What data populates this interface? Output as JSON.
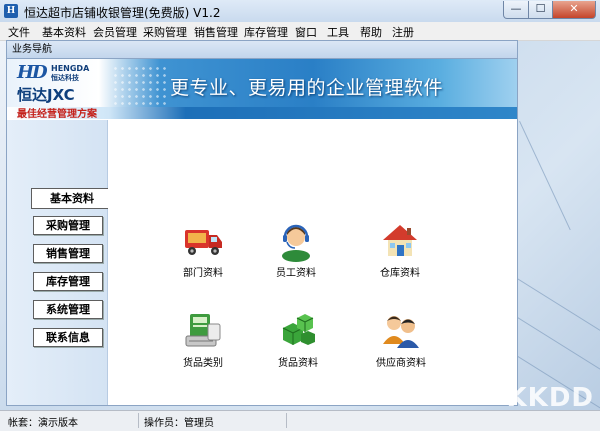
{
  "window": {
    "title": "恒达超市店铺收银管理(免费版) V1.2",
    "icon_label": "H"
  },
  "menu": [
    {
      "label": "文件"
    },
    {
      "label": "基本资料"
    },
    {
      "label": "会员管理"
    },
    {
      "label": "采购管理"
    },
    {
      "label": "销售管理"
    },
    {
      "label": "库存管理"
    },
    {
      "label": "窗口"
    },
    {
      "label": "工具"
    },
    {
      "label": "帮助"
    },
    {
      "label": "注册"
    }
  ],
  "nav_window": {
    "title": "业务导航",
    "banner": {
      "logo_mark": "HD",
      "logo_en": "HENGDA",
      "logo_cn": "恒达科技",
      "brand": "恒达JXC",
      "tagline": "最佳经营管理方案",
      "slogan": "更专业、更易用的企业管理软件"
    },
    "sidebar": [
      {
        "label": "基本资料",
        "active": true
      },
      {
        "label": "采购管理",
        "active": false
      },
      {
        "label": "销售管理",
        "active": false
      },
      {
        "label": "库存管理",
        "active": false
      },
      {
        "label": "系统管理",
        "active": false
      },
      {
        "label": "联系信息",
        "active": false
      }
    ],
    "tiles": [
      {
        "label": "部门资料",
        "icon": "truck-icon"
      },
      {
        "label": "员工资料",
        "icon": "headset-person-icon"
      },
      {
        "label": "仓库资料",
        "icon": "house-icon"
      },
      {
        "label": "货品类别",
        "icon": "goods-box-icon"
      },
      {
        "label": "货品资料",
        "icon": "green-cubes-icon"
      },
      {
        "label": "供应商资料",
        "icon": "people-icon"
      }
    ]
  },
  "status_bar": {
    "account": "帐套：演示版本",
    "operator": "操作员：管理员"
  },
  "watermark": "KKDD",
  "colors": {
    "banner_blue": "#2a7fc6",
    "brand_navy": "#0e3f7d",
    "tagline_red": "#c4211b",
    "close_red": "#c5442a"
  }
}
